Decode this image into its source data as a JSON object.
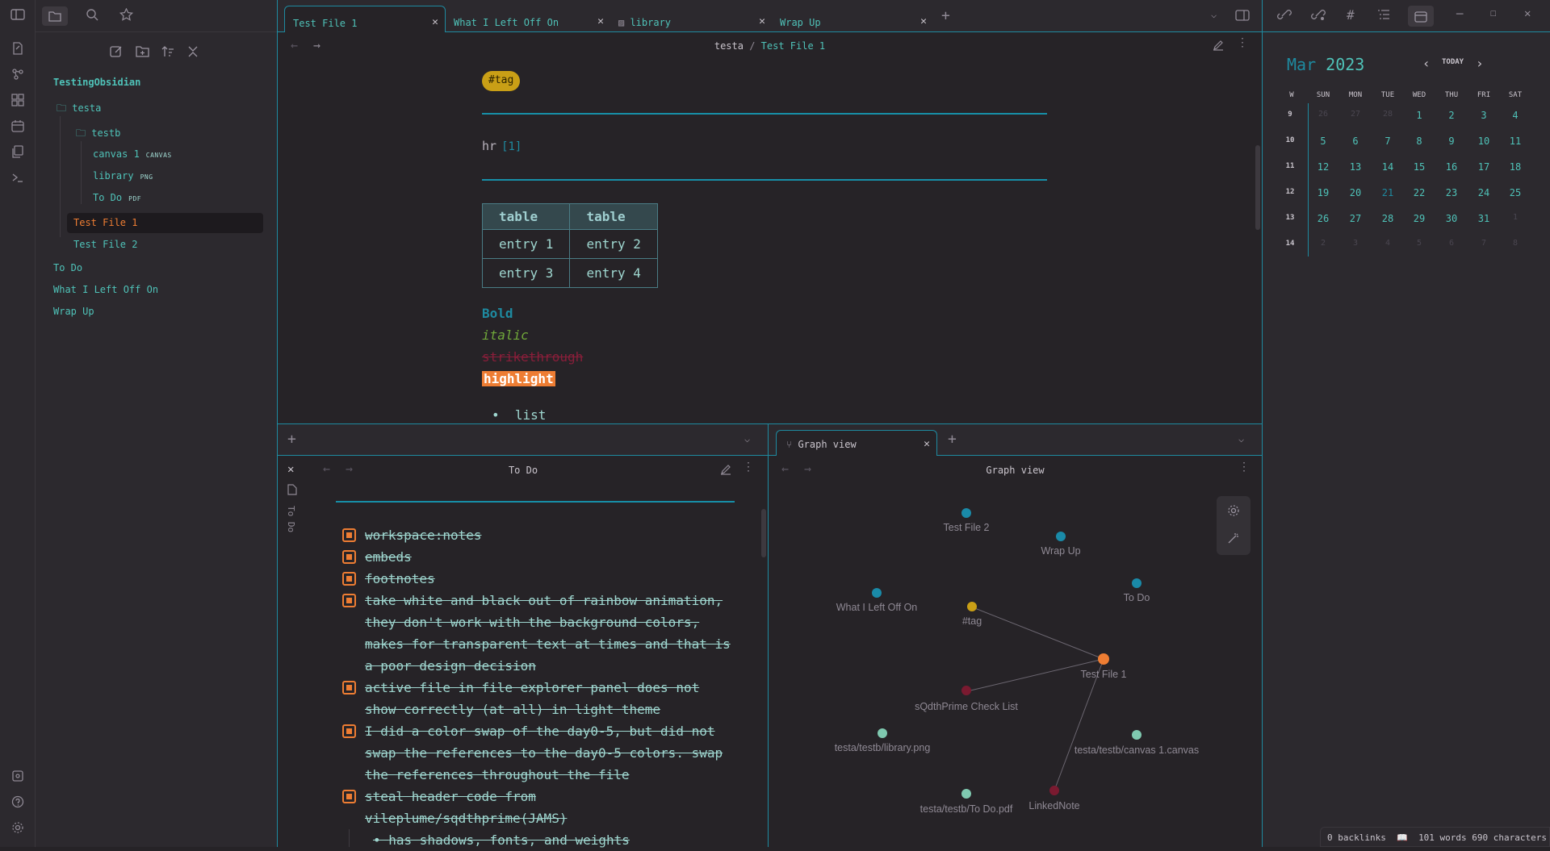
{
  "sidebar": {
    "vault": "TestingObsidian",
    "folder_testa": "testa",
    "folder_testb": "testb",
    "canvas": {
      "name": "canvas 1",
      "badge": "CANVAS"
    },
    "library": {
      "name": "library",
      "badge": "PNG"
    },
    "todo_pdf": {
      "name": "To Do",
      "badge": "PDF"
    },
    "test_file_1": "Test File 1",
    "test_file_2": "Test File 2",
    "root_todo": "To Do",
    "root_wilo": "What I Left Off On",
    "root_wrap": "Wrap Up"
  },
  "tabs": [
    "Test File 1",
    "What I Left Off On",
    "library",
    "Wrap Up"
  ],
  "editor": {
    "crumb_parent": "testa",
    "crumb_sep": "/",
    "crumb_leaf": "Test File 1",
    "tag": "#tag",
    "hr_text": "hr",
    "footnote": "[1]",
    "table_headers": [
      "table",
      "table"
    ],
    "table_rows": [
      [
        "entry 1",
        "entry 2"
      ],
      [
        "entry 3",
        "entry 4"
      ]
    ],
    "bold": "Bold",
    "italic": "italic",
    "strike": "strikethrough",
    "highlight": "highlight",
    "list_item": "list"
  },
  "calendar": {
    "month": "Mar",
    "year": "2023",
    "today_label": "TODAY",
    "headers": [
      "W",
      "SUN",
      "MON",
      "TUE",
      "WED",
      "THU",
      "FRI",
      "SAT"
    ],
    "weeks": [
      {
        "w": "9",
        "days": [
          "26",
          "27",
          "28",
          "1",
          "2",
          "3",
          "4"
        ]
      },
      {
        "w": "10",
        "days": [
          "5",
          "6",
          "7",
          "8",
          "9",
          "10",
          "11"
        ]
      },
      {
        "w": "11",
        "days": [
          "12",
          "13",
          "14",
          "15",
          "16",
          "17",
          "18"
        ]
      },
      {
        "w": "12",
        "days": [
          "19",
          "20",
          "21",
          "22",
          "23",
          "24",
          "25"
        ]
      },
      {
        "w": "13",
        "days": [
          "26",
          "27",
          "28",
          "29",
          "30",
          "31",
          "1"
        ]
      },
      {
        "w": "14",
        "days": [
          "2",
          "3",
          "4",
          "5",
          "6",
          "7",
          "8"
        ]
      }
    ]
  },
  "status": {
    "backlinks": "0 backlinks",
    "words": "101 words",
    "chars": "690 characters"
  },
  "todo_pane": {
    "title": "To Do",
    "side_label": "To Do",
    "items": [
      "workspace:notes",
      "embeds",
      "footnotes",
      "take white and black out of rainbow animation, they don't work with the background colors, makes for transparent text at times and that is a poor design decision",
      "active file in file explorer panel does not show correctly (at all) in light theme",
      "I did a color swap of the day0-5, but did not swap the references to the day0-5 colors. swap the references throughout the file",
      "steal header code from vileplume/sqdthprime(JAMS)"
    ],
    "sub_item": "has shadows, fonts, and weights"
  },
  "graph_pane": {
    "tab_label": "Graph view",
    "title": "Graph view",
    "nodes": [
      "Test File 2",
      "Wrap Up",
      "To Do",
      "What I Left Off On",
      "#tag",
      "Test File 1",
      "sQdthPrime Check List",
      "testa/testb/library.png",
      "testa/testb/canvas 1.canvas",
      "testa/testb/To Do.pdf",
      "LinkedNote"
    ]
  },
  "colors": {
    "accent": "#1e8aa0",
    "teal": "#4fc2b8",
    "orange": "#ee7d33",
    "gold": "#c99f16",
    "crimson": "#8a1e3a"
  }
}
